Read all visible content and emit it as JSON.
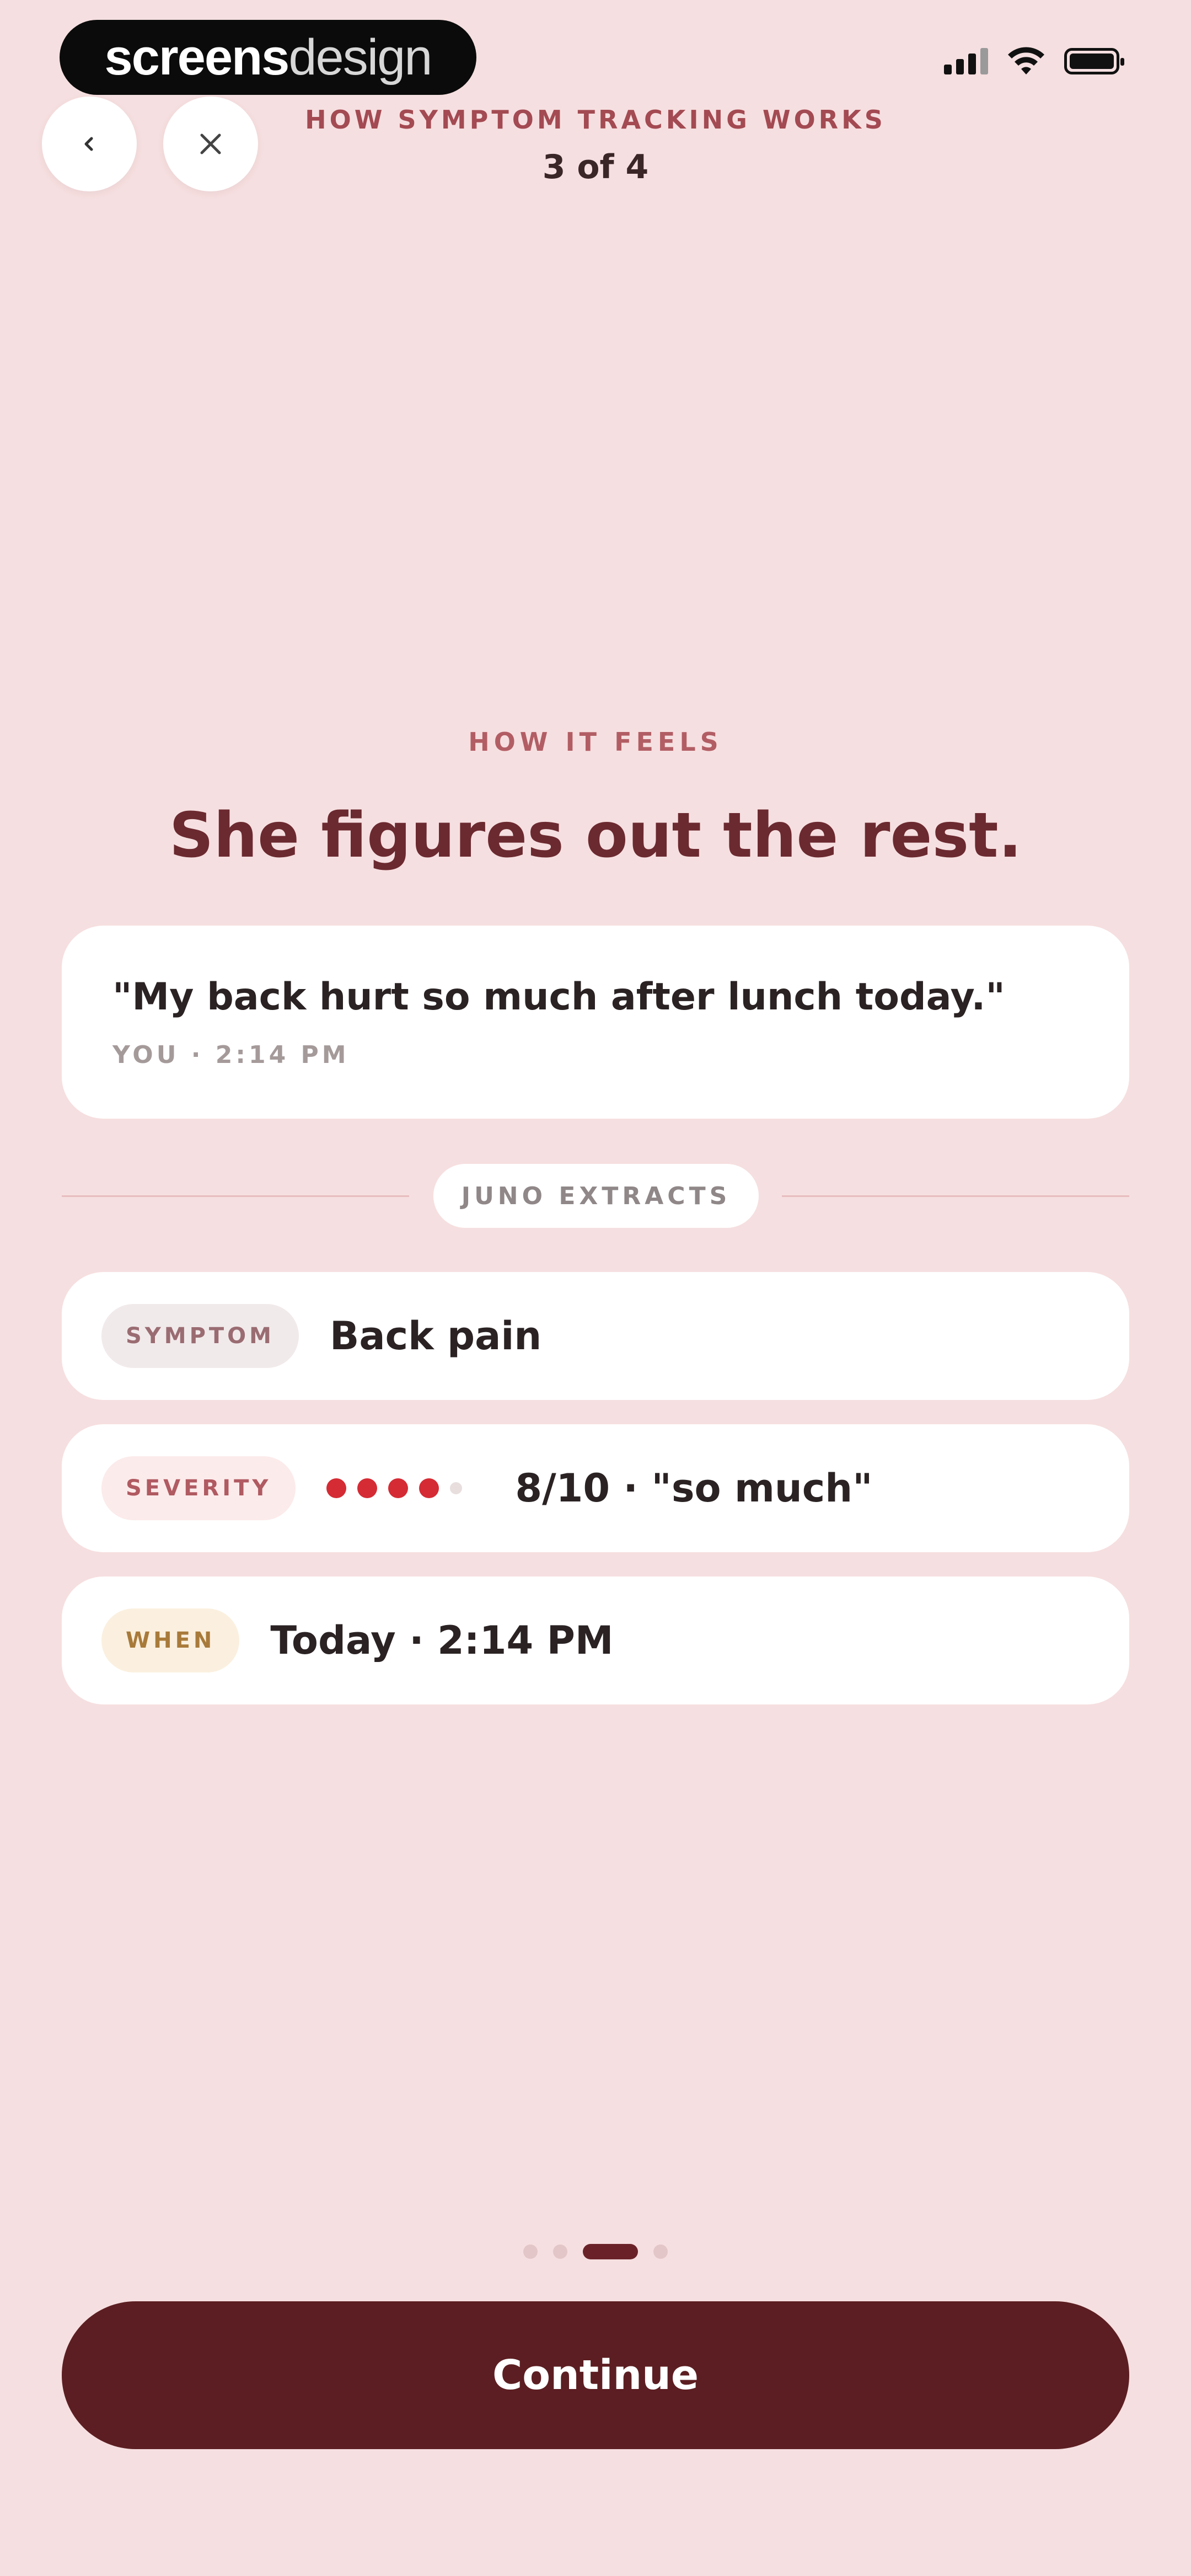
{
  "status_bar": {
    "logo_bold": "screens",
    "logo_light": "design"
  },
  "header": {
    "eyebrow": "HOW SYMPTOM TRACKING WORKS",
    "step": "3 of 4"
  },
  "nav": {
    "back_icon": "chevron-left-icon",
    "close_icon": "close-icon"
  },
  "section": {
    "eyebrow": "HOW IT FEELS",
    "title": "She figures out the rest."
  },
  "quote": {
    "text": "\"My back hurt so much after lunch today.\"",
    "meta": "YOU · 2:14 PM"
  },
  "divider": {
    "label": "JUNO EXTRACTS"
  },
  "extracts": {
    "symptom": {
      "tag": "SYMPTOM",
      "value": "Back pain"
    },
    "severity": {
      "tag": "SEVERITY",
      "filled": 4,
      "total": 5,
      "value": "8/10 · \"so much\""
    },
    "when": {
      "tag": "WHEN",
      "value": "Today · 2:14 PM"
    }
  },
  "pager": {
    "pages": 4,
    "current": 3
  },
  "continue_label": "Continue",
  "colors": {
    "background": "#f6dfe0",
    "primary": "#5c1e22",
    "accent_red": "#d52b34"
  }
}
